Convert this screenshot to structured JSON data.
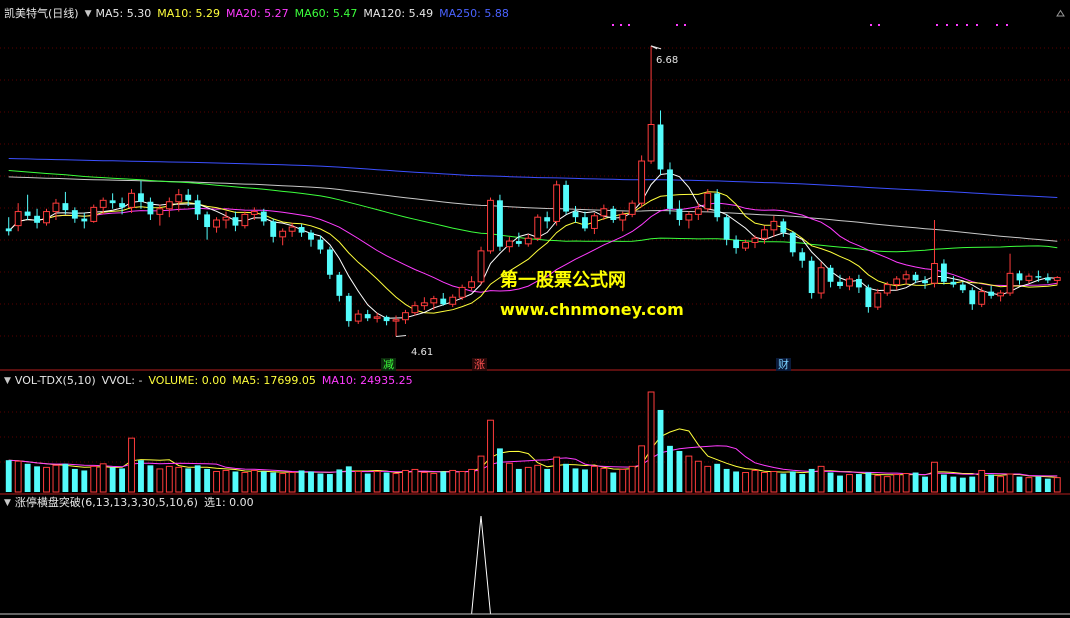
{
  "main_header": {
    "title": "凯美特气(日线)",
    "ma5": "MA5: 5.30",
    "ma10": "MA10: 5.29",
    "ma20": "MA20: 5.27",
    "ma60": "MA60: 5.47",
    "ma120": "MA120: 5.49",
    "ma250": "MA250: 5.88"
  },
  "vol_header": {
    "name": "VOL-TDX(5,10)",
    "vvol": "VVOL: -",
    "volume": "VOLUME: 0.00",
    "ma5": "MA5: 17699.05",
    "ma10": "MA10: 24935.25"
  },
  "ind_header": {
    "name": "涨停横盘突破(6,13,13,3,30,5,10,6)",
    "value": "选1: 0.00"
  },
  "annotations": {
    "high": "6.68",
    "low": "4.61",
    "tag_jian": "减",
    "tag_zhang": "涨",
    "tag_cai": "财"
  },
  "watermark": {
    "line1": "第一股票公式网",
    "line2": "www.chnmoney.com"
  },
  "colors": {
    "background": "#000000",
    "up": "#ff3c3c",
    "down": "#54fcfc",
    "ma5": "#ffffff",
    "ma10": "#ffff3c",
    "ma20": "#ff3cff",
    "ma60": "#3cff3c",
    "ma120": "#c8c8c8",
    "ma250": "#3c50ff",
    "signal": "#ffffff",
    "divider": "#b41e1e"
  },
  "chart_data": {
    "type": "candlestick",
    "ylim": [
      4.5,
      6.85
    ],
    "high": 6.68,
    "low": 4.61,
    "candles": [
      [
        5.38,
        5.46,
        5.33,
        5.36
      ],
      [
        5.4,
        5.56,
        5.36,
        5.5
      ],
      [
        5.5,
        5.62,
        5.44,
        5.47
      ],
      [
        5.47,
        5.52,
        5.38,
        5.42
      ],
      [
        5.42,
        5.52,
        5.4,
        5.5
      ],
      [
        5.5,
        5.59,
        5.44,
        5.56
      ],
      [
        5.56,
        5.64,
        5.48,
        5.51
      ],
      [
        5.51,
        5.53,
        5.42,
        5.45
      ],
      [
        5.45,
        5.49,
        5.38,
        5.43
      ],
      [
        5.43,
        5.55,
        5.42,
        5.53
      ],
      [
        5.53,
        5.6,
        5.48,
        5.58
      ],
      [
        5.58,
        5.63,
        5.52,
        5.56
      ],
      [
        5.56,
        5.6,
        5.48,
        5.53
      ],
      [
        5.53,
        5.66,
        5.49,
        5.63
      ],
      [
        5.63,
        5.72,
        5.52,
        5.57
      ],
      [
        5.57,
        5.6,
        5.44,
        5.48
      ],
      [
        5.48,
        5.55,
        5.4,
        5.52
      ],
      [
        5.52,
        5.6,
        5.46,
        5.57
      ],
      [
        5.57,
        5.66,
        5.5,
        5.62
      ],
      [
        5.62,
        5.66,
        5.54,
        5.58
      ],
      [
        5.58,
        5.62,
        5.44,
        5.48
      ],
      [
        5.48,
        5.5,
        5.3,
        5.39
      ],
      [
        5.39,
        5.46,
        5.35,
        5.44
      ],
      [
        5.44,
        5.5,
        5.38,
        5.46
      ],
      [
        5.46,
        5.5,
        5.36,
        5.4
      ],
      [
        5.4,
        5.5,
        5.38,
        5.48
      ],
      [
        5.48,
        5.53,
        5.44,
        5.5
      ],
      [
        5.5,
        5.52,
        5.4,
        5.43
      ],
      [
        5.43,
        5.45,
        5.28,
        5.32
      ],
      [
        5.32,
        5.38,
        5.26,
        5.36
      ],
      [
        5.36,
        5.42,
        5.32,
        5.39
      ],
      [
        5.39,
        5.41,
        5.32,
        5.35
      ],
      [
        5.35,
        5.37,
        5.25,
        5.3
      ],
      [
        5.3,
        5.33,
        5.2,
        5.23
      ],
      [
        5.23,
        5.25,
        5.02,
        5.05
      ],
      [
        5.05,
        5.07,
        4.86,
        4.9
      ],
      [
        4.9,
        4.92,
        4.68,
        4.72
      ],
      [
        4.72,
        4.8,
        4.7,
        4.77
      ],
      [
        4.77,
        4.8,
        4.72,
        4.74
      ],
      [
        4.74,
        4.78,
        4.71,
        4.75
      ],
      [
        4.75,
        4.76,
        4.69,
        4.72
      ],
      [
        4.72,
        4.76,
        4.61,
        4.73
      ],
      [
        4.73,
        4.8,
        4.7,
        4.78
      ],
      [
        4.78,
        4.86,
        4.76,
        4.83
      ],
      [
        4.83,
        4.89,
        4.8,
        4.85
      ],
      [
        4.85,
        4.9,
        4.8,
        4.88
      ],
      [
        4.88,
        4.92,
        4.83,
        4.84
      ],
      [
        4.84,
        4.91,
        4.82,
        4.89
      ],
      [
        4.89,
        4.98,
        4.87,
        4.96
      ],
      [
        4.96,
        5.04,
        4.94,
        5.0
      ],
      [
        5.0,
        5.25,
        4.98,
        5.22
      ],
      [
        5.22,
        5.6,
        5.2,
        5.58
      ],
      [
        5.58,
        5.62,
        5.22,
        5.25
      ],
      [
        5.25,
        5.32,
        5.21,
        5.29
      ],
      [
        5.29,
        5.35,
        5.25,
        5.27
      ],
      [
        5.27,
        5.34,
        5.25,
        5.31
      ],
      [
        5.31,
        5.48,
        5.29,
        5.46
      ],
      [
        5.46,
        5.5,
        5.38,
        5.43
      ],
      [
        5.43,
        5.72,
        5.4,
        5.69
      ],
      [
        5.69,
        5.72,
        5.48,
        5.5
      ],
      [
        5.5,
        5.54,
        5.42,
        5.46
      ],
      [
        5.46,
        5.5,
        5.36,
        5.38
      ],
      [
        5.38,
        5.49,
        5.34,
        5.47
      ],
      [
        5.47,
        5.55,
        5.44,
        5.52
      ],
      [
        5.52,
        5.54,
        5.42,
        5.44
      ],
      [
        5.44,
        5.5,
        5.36,
        5.48
      ],
      [
        5.48,
        5.58,
        5.46,
        5.56
      ],
      [
        5.56,
        5.9,
        5.53,
        5.86
      ],
      [
        5.86,
        6.68,
        5.84,
        6.12
      ],
      [
        6.12,
        6.22,
        5.76,
        5.8
      ],
      [
        5.8,
        5.85,
        5.48,
        5.52
      ],
      [
        5.52,
        5.58,
        5.4,
        5.44
      ],
      [
        5.44,
        5.5,
        5.38,
        5.48
      ],
      [
        5.48,
        5.56,
        5.44,
        5.52
      ],
      [
        5.52,
        5.66,
        5.5,
        5.63
      ],
      [
        5.63,
        5.66,
        5.43,
        5.46
      ],
      [
        5.46,
        5.48,
        5.26,
        5.3
      ],
      [
        5.3,
        5.33,
        5.2,
        5.24
      ],
      [
        5.24,
        5.3,
        5.22,
        5.28
      ],
      [
        5.28,
        5.33,
        5.24,
        5.31
      ],
      [
        5.31,
        5.4,
        5.27,
        5.37
      ],
      [
        5.37,
        5.47,
        5.32,
        5.43
      ],
      [
        5.43,
        5.45,
        5.32,
        5.35
      ],
      [
        5.35,
        5.36,
        5.18,
        5.21
      ],
      [
        5.21,
        5.24,
        5.1,
        5.15
      ],
      [
        5.15,
        5.18,
        4.88,
        4.92
      ],
      [
        4.92,
        5.14,
        4.88,
        5.1
      ],
      [
        5.1,
        5.12,
        4.96,
        5.0
      ],
      [
        5.0,
        5.05,
        4.95,
        4.97
      ],
      [
        4.97,
        5.04,
        4.94,
        5.02
      ],
      [
        5.02,
        5.05,
        4.92,
        4.96
      ],
      [
        4.96,
        4.98,
        4.78,
        4.82
      ],
      [
        4.82,
        4.95,
        4.8,
        4.92
      ],
      [
        4.92,
        5.0,
        4.9,
        4.98
      ],
      [
        4.98,
        5.04,
        4.94,
        5.02
      ],
      [
        5.02,
        5.08,
        4.98,
        5.05
      ],
      [
        5.05,
        5.07,
        4.99,
        5.01
      ],
      [
        5.01,
        5.04,
        4.95,
        4.99
      ],
      [
        4.99,
        5.44,
        4.96,
        5.13
      ],
      [
        5.13,
        5.16,
        4.98,
        5.0
      ],
      [
        5.0,
        5.04,
        4.96,
        4.98
      ],
      [
        4.98,
        5.0,
        4.92,
        4.94
      ],
      [
        4.94,
        4.96,
        4.8,
        4.84
      ],
      [
        4.84,
        4.96,
        4.82,
        4.93
      ],
      [
        4.93,
        4.97,
        4.88,
        4.9
      ],
      [
        4.9,
        4.94,
        4.86,
        4.92
      ],
      [
        4.92,
        5.2,
        4.9,
        5.06
      ],
      [
        5.06,
        5.08,
        4.98,
        5.01
      ],
      [
        5.01,
        5.06,
        4.99,
        5.04
      ],
      [
        5.04,
        5.08,
        5.0,
        5.03
      ],
      [
        5.03,
        5.06,
        4.99,
        5.01
      ],
      [
        5.01,
        5.04,
        4.98,
        5.03
      ]
    ],
    "volume": [
      0.62,
      0.6,
      0.55,
      0.5,
      0.48,
      0.52,
      0.55,
      0.45,
      0.42,
      0.5,
      0.55,
      0.48,
      0.46,
      1.05,
      0.62,
      0.52,
      0.45,
      0.5,
      0.48,
      0.46,
      0.52,
      0.45,
      0.4,
      0.42,
      0.4,
      0.38,
      0.42,
      0.4,
      0.38,
      0.36,
      0.38,
      0.42,
      0.4,
      0.36,
      0.35,
      0.44,
      0.5,
      0.4,
      0.36,
      0.4,
      0.38,
      0.36,
      0.42,
      0.44,
      0.38,
      0.36,
      0.4,
      0.42,
      0.4,
      0.44,
      0.7,
      1.4,
      0.85,
      0.56,
      0.45,
      0.48,
      0.52,
      0.45,
      0.68,
      0.55,
      0.46,
      0.44,
      0.5,
      0.46,
      0.38,
      0.44,
      0.5,
      0.9,
      1.95,
      1.6,
      0.9,
      0.8,
      0.7,
      0.6,
      0.5,
      0.55,
      0.45,
      0.4,
      0.38,
      0.42,
      0.38,
      0.4,
      0.36,
      0.4,
      0.35,
      0.45,
      0.5,
      0.38,
      0.32,
      0.34,
      0.35,
      0.38,
      0.32,
      0.3,
      0.34,
      0.36,
      0.38,
      0.3,
      0.58,
      0.34,
      0.3,
      0.28,
      0.3,
      0.42,
      0.34,
      0.3,
      0.35,
      0.3,
      0.28,
      0.3,
      0.26,
      0.28
    ],
    "signal": {
      "index": 50,
      "value": 1
    }
  }
}
